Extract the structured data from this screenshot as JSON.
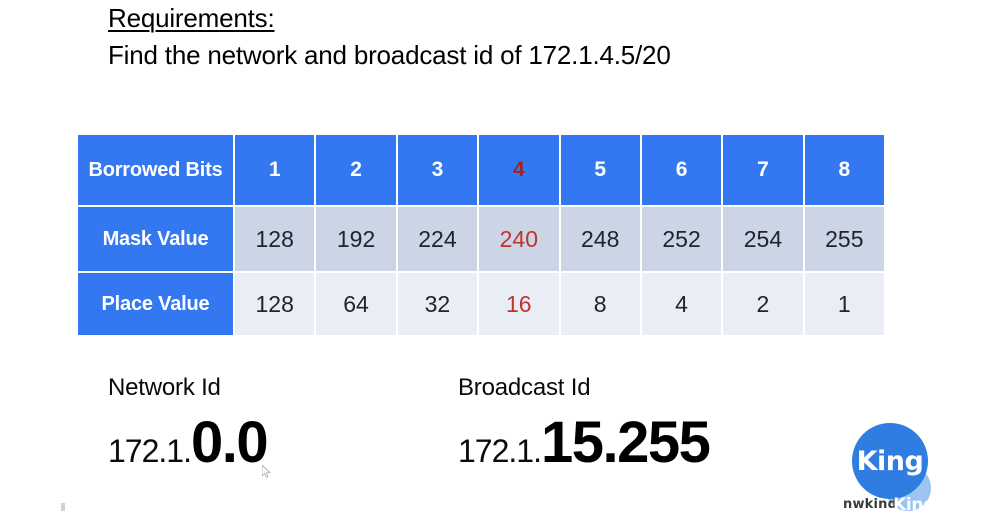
{
  "slide": {
    "requirements_heading": "Requirements:",
    "requirements_text": "Find the network and broadcast id of 172.1.4.5/20"
  },
  "table": {
    "row_labels": [
      "Borrowed Bits",
      "Mask Value",
      "Place Value"
    ],
    "borrowed_bits": [
      "1",
      "2",
      "3",
      "4",
      "5",
      "6",
      "7",
      "8"
    ],
    "mask_values": [
      "128",
      "192",
      "224",
      "240",
      "248",
      "252",
      "254",
      "255"
    ],
    "place_values": [
      "128",
      "64",
      "32",
      "16",
      "8",
      "4",
      "2",
      "1"
    ],
    "highlight_column_index": 3,
    "colors": {
      "header_blue": "#3378f0",
      "mask_row_bg": "#ccd5e6",
      "place_row_bg": "#e9edf5",
      "highlight_header_red": "#a02424",
      "highlight_body_red": "#c0342b",
      "header_text": "#ffffff",
      "body_text": "#20242c"
    }
  },
  "results": {
    "network": {
      "label": "Network Id",
      "prefix": "172.1.",
      "value": "0.0"
    },
    "broadcast": {
      "label": "Broadcast Id",
      "prefix": "172.1.",
      "value": "15.255"
    }
  },
  "logo": {
    "circle_text": "King",
    "subtext": "nwkind",
    "ghost_text": "King",
    "circle_color": "#2f7de0"
  }
}
